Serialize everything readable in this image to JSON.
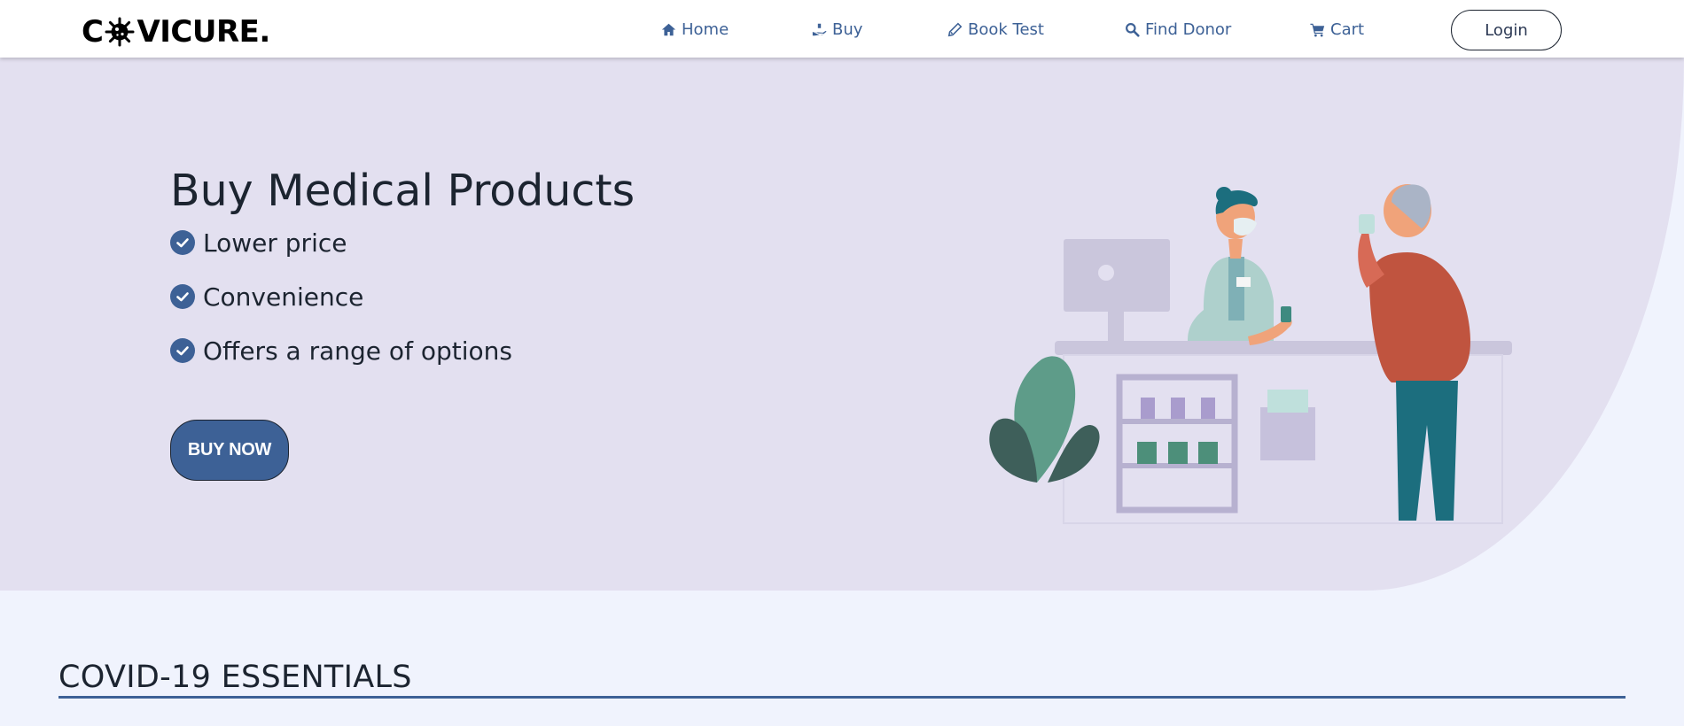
{
  "brand": {
    "logo_prefix": "C",
    "logo_suffix": "VICURE."
  },
  "nav": {
    "items": [
      {
        "label": "Home",
        "icon": "home-icon"
      },
      {
        "label": "Buy",
        "icon": "hand-holding-icon"
      },
      {
        "label": "Book Test",
        "icon": "pen-icon"
      },
      {
        "label": "Find Donor",
        "icon": "search-icon"
      },
      {
        "label": "Cart",
        "icon": "cart-icon"
      }
    ],
    "login_label": "Login"
  },
  "hero": {
    "title": "Buy Medical Products",
    "features": [
      "Lower price",
      "Convenience",
      "Offers a range of options"
    ],
    "cta_label": "BUY NOW",
    "illustration": "pharmacist-serving-customer-illustration"
  },
  "essentials": {
    "title": "COVID-19 ESSENTIALS"
  },
  "colors": {
    "accent": "#3d6196",
    "hero_bg": "#e3e0f0",
    "page_bg": "#f0f3fd",
    "text": "#1c2430"
  }
}
